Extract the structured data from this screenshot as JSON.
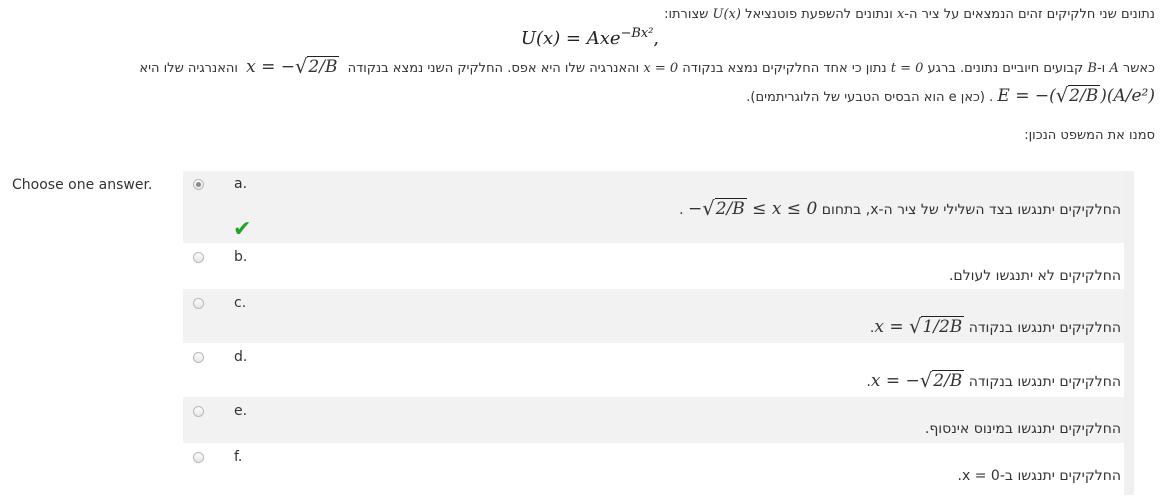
{
  "question": {
    "line1_text": "נתונים שני חלקיקים זהים הנמצאים על ציר ה-",
    "line1_x": "x",
    "line1_text2": " ונתונים להשפעת פוטנציאל ",
    "line1_u": "U(x)",
    "line1_text3": " שצורתו:",
    "equation": "U(x) = Axe",
    "equation_exp": "−Bx²",
    "equation_tail": ",",
    "line2_a": "כאשר ",
    "line2_A": "A",
    "line2_b": " ו-",
    "line2_B": "B",
    "line2_c": " קבועים חיוביים נתונים. ברגע ",
    "line2_t0": "t = 0",
    "line2_d": " נתון כי אחד החלקיקים נמצא בנקודה ",
    "line2_x0": "x = 0",
    "line2_e": " והאנרגיה שלו היא אפס. החלקיק השני נמצא בנקודה ",
    "line2_xeq": "x = −",
    "line2_sqrt": "2/B",
    "line2_f": " והאנרגיה שלו היא",
    "line3_E": "E = −(",
    "line3_sqrt": "2/B",
    "line3_E2": ")(A/e²)",
    "line3_note": " . (כאן e הוא הבסיס הטבעי של הלוגריתמים).",
    "instruction": "סמנו את המשפט הנכון:"
  },
  "choose_label": "Choose one answer.",
  "answers": [
    {
      "letter": "a.",
      "text": "החלקיקים יתנגשו בצד השלילי של ציר ה-x, בתחום ",
      "math_pre": "−",
      "math_sqrt": "2/B",
      "math_post": " ≤ x ≤ 0",
      "tail": " .",
      "selected": true,
      "correct_icon": "checkmark-icon"
    },
    {
      "letter": "b.",
      "text": "החלקיקים לא יתנגשו לעולם.",
      "selected": false
    },
    {
      "letter": "c.",
      "text": "החלקיקים יתנגשו בנקודה ",
      "math_pre": "x = ",
      "math_sqrt": "1/2B",
      "math_post": "",
      "tail": ".",
      "selected": false
    },
    {
      "letter": "d.",
      "text": "החלקיקים יתנגשו בנקודה ",
      "math_pre": "x = −",
      "math_sqrt": "2/B",
      "math_post": "",
      "tail": ".",
      "selected": false
    },
    {
      "letter": "e.",
      "text": "החלקיקים יתנגשו במינוס אינסוף.",
      "selected": false
    },
    {
      "letter": "f.",
      "text": "החלקיקים יתנגשו ב-0 = x.",
      "selected": false
    }
  ],
  "colors": {
    "check": "#2aa12a",
    "shade": "#f2f2f2"
  }
}
